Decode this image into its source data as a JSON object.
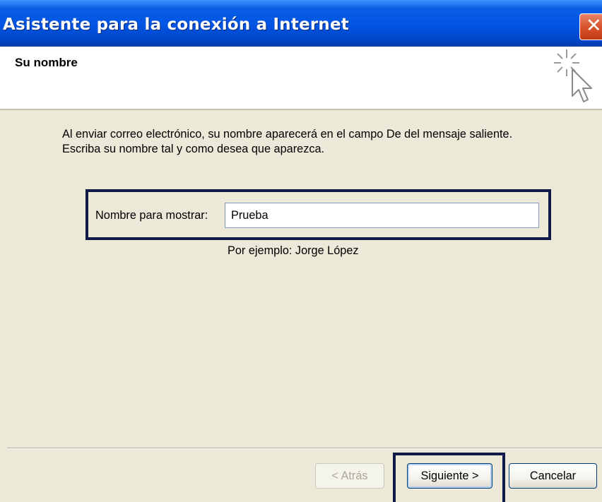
{
  "window": {
    "title": "Asistente para la conexión a Internet",
    "close_symbol": "✕"
  },
  "header": {
    "title": "Su nombre",
    "icon": "wizard-cursor-sparkle-icon"
  },
  "body": {
    "description": "Al enviar correo electrónico, su nombre aparecerá en el campo De del mensaje saliente. Escriba su nombre tal y como desea que aparezca.",
    "name_label": "Nombre para mostrar:",
    "name_value": "Prueba",
    "example": "Por ejemplo: Jorge López"
  },
  "buttons": {
    "back": "< Atrás",
    "next": "Siguiente >",
    "cancel": "Cancelar"
  },
  "colors": {
    "titlebar": "#0054e3",
    "dialog_bg": "#ece9d8",
    "highlight_box": "#0f1a48",
    "close_button": "#d9532c"
  }
}
